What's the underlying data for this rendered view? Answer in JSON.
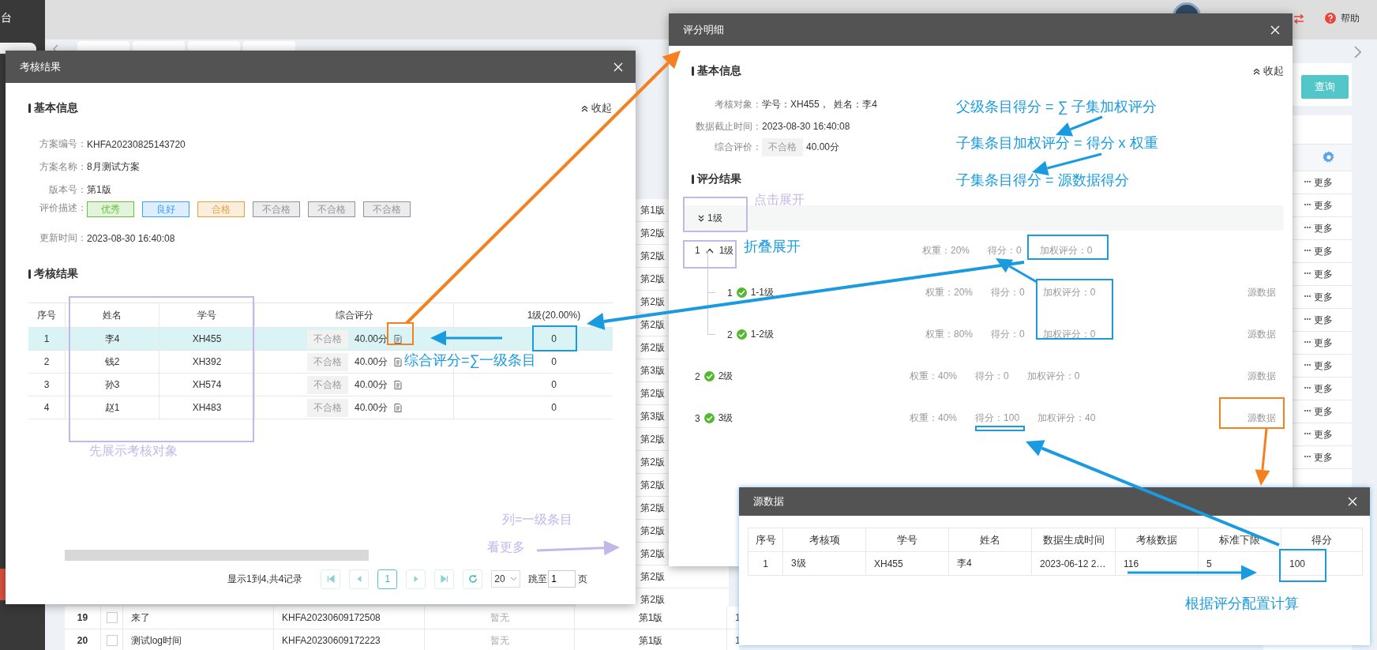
{
  "app": {
    "sidebar_title": "台",
    "help": "帮助",
    "query_button": "查询"
  },
  "background_table": {
    "versions": [
      "第1版",
      "第2版",
      "第2版",
      "第2版",
      "第2版",
      "第2版",
      "第2版",
      "第3版",
      "第2版",
      "第3版",
      "第2版",
      "第2版",
      "第2版",
      "第2版",
      "第2版",
      "第2版",
      "第2版",
      "第2版"
    ],
    "more_links": [
      "更多",
      "更多",
      "更多",
      "更多",
      "更多",
      "更多",
      "更多",
      "更多",
      "更多",
      "更多",
      "更多",
      "更多",
      "更多"
    ],
    "bottom_rows": [
      {
        "index": "19",
        "checked": false,
        "name": "来了",
        "code": "KHFA20230609172508",
        "status": "暂无",
        "version": "第1版",
        "column_7": "1"
      },
      {
        "index": "20",
        "checked": false,
        "name": "测试log时间",
        "code": "KHFA20230609172223",
        "status": "暂无",
        "version": "第1版",
        "column_7": "1"
      }
    ]
  },
  "result_dialog": {
    "title": "考核结果",
    "basic_heading": "基本信息",
    "collapse": "收起",
    "fields": [
      {
        "kind": "text",
        "label": "方案编号：",
        "value": "KHFA20230825143720"
      },
      {
        "kind": "text",
        "label": "方案名称：",
        "value": "8月测试方案"
      },
      {
        "kind": "text",
        "label": "版本号：",
        "value": "第1版"
      },
      {
        "kind": "tags",
        "label": "评价描述：",
        "tags": [
          {
            "label": "优秀",
            "color": "#67c23a"
          },
          {
            "label": "良好",
            "color": "#409eff"
          },
          {
            "label": "合格",
            "color": "#e6a23c"
          },
          {
            "label": "不合格",
            "color": "#909399"
          },
          {
            "label": "不合格",
            "color": "#909399"
          },
          {
            "label": "不合格",
            "color": "#909399"
          }
        ]
      },
      {
        "kind": "text",
        "label": "更新时间：",
        "value": "2023-08-30 16:40:08"
      }
    ],
    "result_heading": "考核结果",
    "columns": [
      "序号",
      "姓名",
      "学号",
      "综合评分",
      "1级(20.00%)"
    ],
    "rows": [
      {
        "index": "1",
        "name": "李4",
        "student_no": "XH455",
        "grade": "不合格",
        "score": "40.00分",
        "level_1": "0",
        "selected": true
      },
      {
        "index": "2",
        "name": "钱2",
        "student_no": "XH392",
        "grade": "不合格",
        "score": "40.00分",
        "level_1": "0",
        "selected": false
      },
      {
        "index": "3",
        "name": "孙3",
        "student_no": "XH574",
        "grade": "不合格",
        "score": "40.00分",
        "level_1": "0",
        "selected": false
      },
      {
        "index": "4",
        "name": "赵1",
        "student_no": "XH483",
        "grade": "不合格",
        "score": "40.00分",
        "level_1": "0",
        "selected": false
      }
    ],
    "pager": {
      "summary": "显示1到4,共4记录",
      "pages": [
        {
          "label": "1",
          "selected": true
        }
      ],
      "page_size": "20",
      "jump_label": "跳至",
      "jump_value": "1",
      "page_unit": "页"
    }
  },
  "detail_dialog": {
    "title": "评分明细",
    "basic_heading": "基本信息",
    "collapse": "收起",
    "fields": [
      {
        "kind": "text",
        "label": "考核对象：",
        "value": "学号：XH455，  姓名：李4"
      },
      {
        "kind": "text",
        "label": "数据截止时间：",
        "value": "2023-08-30 16:40:08"
      },
      {
        "kind": "grade",
        "label": "综合评价：",
        "tag": "不合格",
        "value": "40.00分"
      }
    ],
    "result_heading": "评分结果",
    "group": {
      "label": "1级",
      "expanded": false
    },
    "items": [
      {
        "index": "1",
        "label": "1级",
        "expanded": true,
        "weight": "权重：20%",
        "score": "得分：0",
        "weighted": "加权评分：0",
        "children": [
          {
            "index": "1",
            "label": "1-1级",
            "checked": true,
            "weight": "权重：20%",
            "score": "得分：0",
            "weighted": "加权评分：0",
            "source": "源数据"
          },
          {
            "index": "2",
            "label": "1-2级",
            "checked": true,
            "weight": "权重：80%",
            "score": "得分：0",
            "weighted": "加权评分：0",
            "source": "源数据"
          }
        ]
      },
      {
        "index": "2",
        "label": "2级",
        "checked": true,
        "weight": "权重：40%",
        "score": "得分：0",
        "weighted": "加权评分：0",
        "source": "源数据"
      },
      {
        "index": "3",
        "label": "3级",
        "checked": true,
        "weight": "权重：40%",
        "score": "得分：100",
        "weighted": "加权评分：40",
        "source": "源数据"
      }
    ]
  },
  "source_dialog": {
    "title": "源数据",
    "columns": [
      "序号",
      "考核项",
      "学号",
      "姓名",
      "数据生成时间",
      "考核数据",
      "标准下限",
      "得分"
    ],
    "rows": [
      {
        "cells": [
          "1",
          "3级",
          "XH455",
          "李4",
          "2023-06-12 2…",
          "116",
          "5",
          "100"
        ]
      }
    ]
  },
  "annotations": [
    {
      "text": "先展示考核对象",
      "color": "#c4b8e8"
    },
    {
      "text": "综合评分=∑一级条目",
      "color": "#1a9be0"
    },
    {
      "text": "列=一级条目",
      "color": "#c4b8e8"
    },
    {
      "text": "看更多",
      "color": "#c4b8e8"
    },
    {
      "text": "点击展开",
      "color": "#c4b8e8"
    },
    {
      "text": "折叠展开",
      "color": "#1a9be0"
    },
    {
      "text": "父级条目得分 = ∑ 子集加权评分",
      "color": "#1a9be0"
    },
    {
      "text": "子集条目加权评分 = 得分 x 权重",
      "color": "#1a9be0"
    },
    {
      "text": "子集条目得分 = 源数据得分",
      "color": "#1a9be0"
    },
    {
      "text": "根据评分配置计算",
      "color": "#1a9be0"
    }
  ]
}
